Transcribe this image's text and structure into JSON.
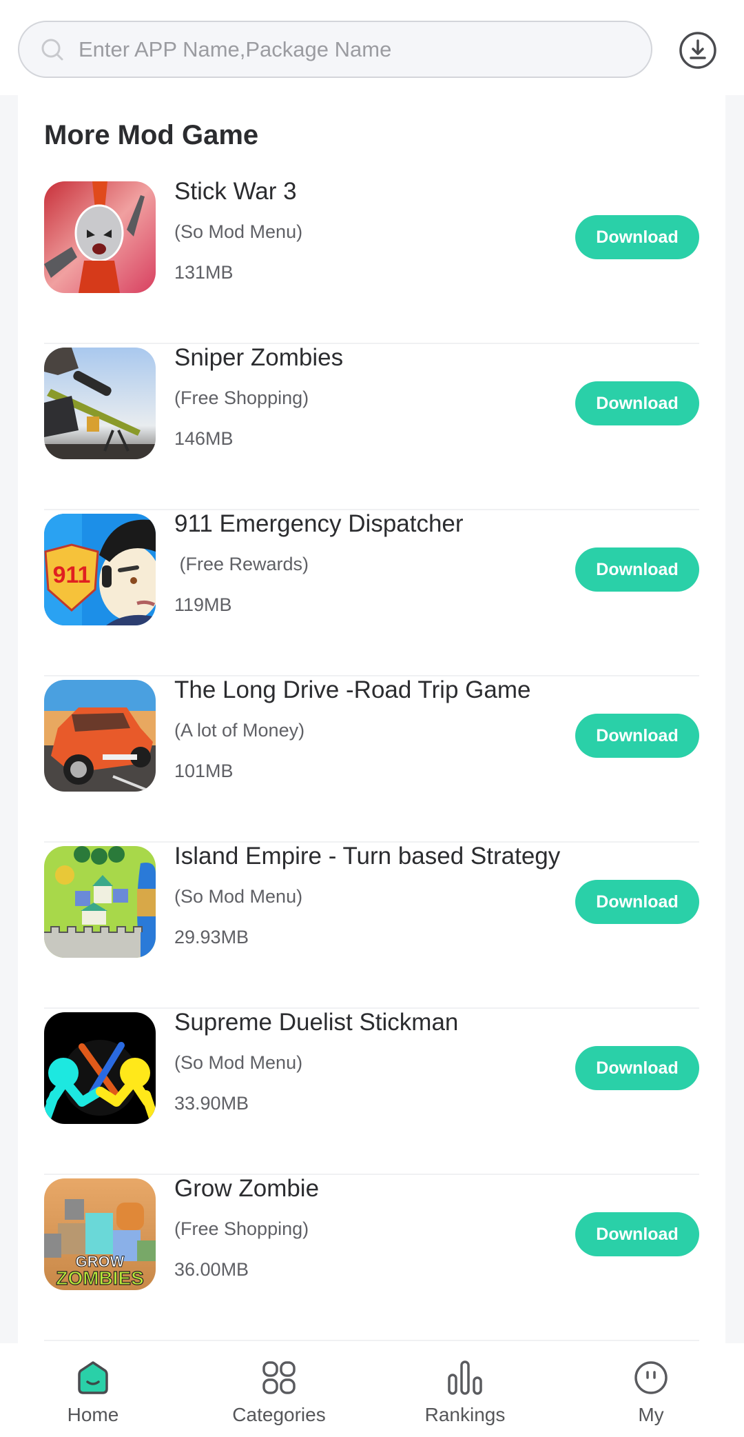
{
  "search": {
    "placeholder": "Enter APP Name,Package Name",
    "value": ""
  },
  "section": {
    "title": "More Mod Game"
  },
  "colors": {
    "accent": "#2ad0a8",
    "page_bg": "#f5f6f8"
  },
  "apps": [
    {
      "title": "Stick War 3",
      "mod": "(So Mod Menu)",
      "size": "131MB",
      "button": "Download",
      "icon": "stick-war-3-app-icon"
    },
    {
      "title": "Sniper Zombies",
      "mod": "(Free Shopping)",
      "size": "146MB",
      "button": "Download",
      "icon": "sniper-zombies-app-icon"
    },
    {
      "title": "911 Emergency Dispatcher",
      "mod": " (Free Rewards)",
      "size": "119MB",
      "button": "Download",
      "icon": "911-emergency-dispatcher-app-icon"
    },
    {
      "title": "The Long Drive -Road Trip Game",
      "mod": "(A lot of Money)",
      "size": "101MB",
      "button": "Download",
      "icon": "the-long-drive-app-icon"
    },
    {
      "title": "Island Empire - Turn based Strategy",
      "mod": "(So Mod Menu)",
      "size": "29.93MB",
      "button": "Download",
      "icon": "island-empire-app-icon"
    },
    {
      "title": "Supreme Duelist Stickman",
      "mod": "(So Mod Menu)",
      "size": "33.90MB",
      "button": "Download",
      "icon": "supreme-duelist-stickman-app-icon"
    },
    {
      "title": "Grow Zombie",
      "mod": "(Free Shopping)",
      "size": "36.00MB",
      "button": "Download",
      "icon": "grow-zombie-app-icon"
    }
  ],
  "nav": {
    "items": [
      {
        "label": "Home",
        "icon": "home-icon",
        "active": true
      },
      {
        "label": "Categories",
        "icon": "categories-icon",
        "active": false
      },
      {
        "label": "Rankings",
        "icon": "rankings-icon",
        "active": false
      },
      {
        "label": "My",
        "icon": "profile-icon",
        "active": false
      }
    ]
  }
}
